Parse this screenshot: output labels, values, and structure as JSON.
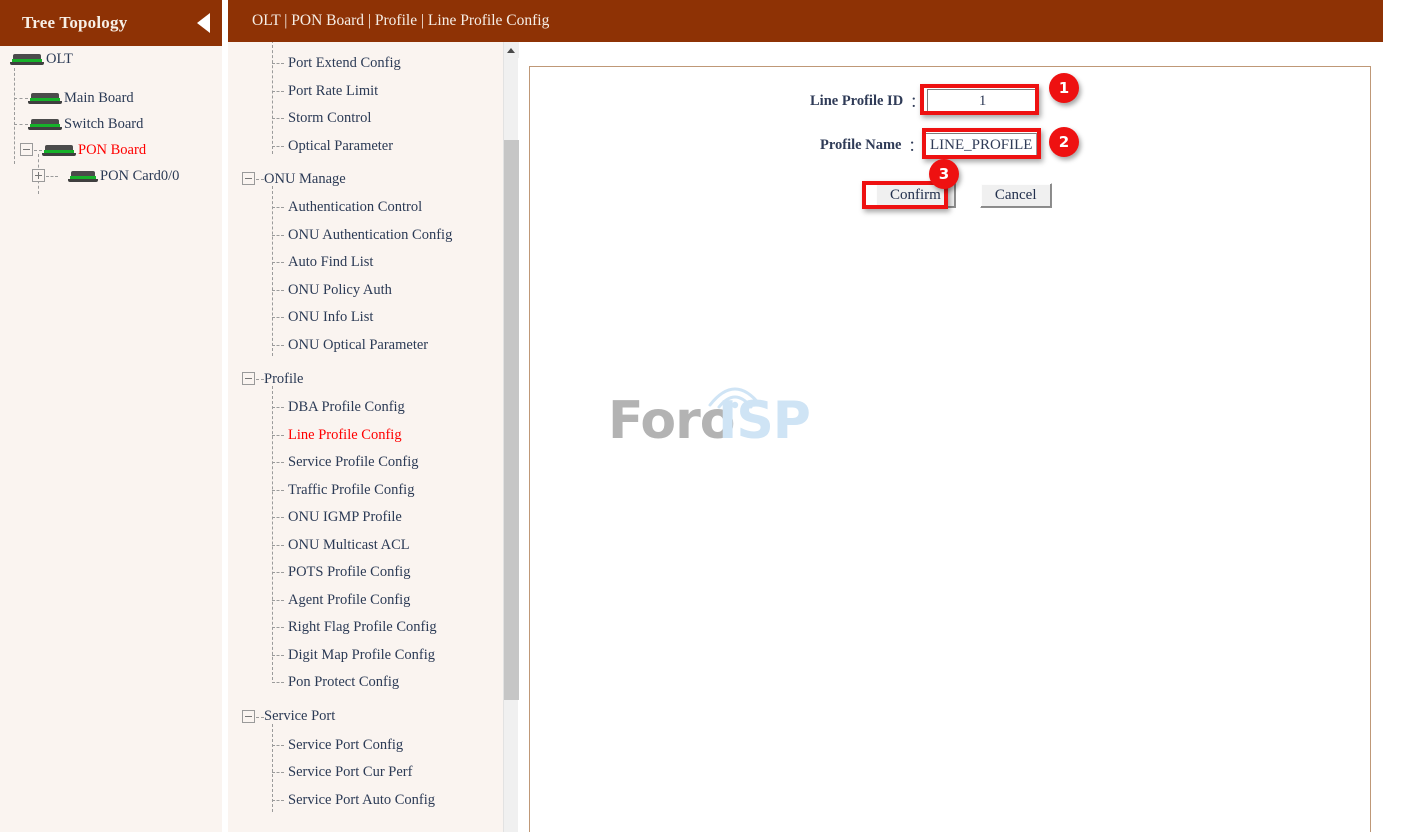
{
  "tree_panel": {
    "title": "Tree Topology",
    "collapse_icon": "triangle-left-icon",
    "nodes": [
      {
        "label": "OLT",
        "level": 0,
        "icon": "board-icon",
        "toggle": "none",
        "highlight": false
      },
      {
        "label": "Main Board",
        "level": 1,
        "icon": "board-icon",
        "toggle": "none",
        "highlight": false
      },
      {
        "label": "Switch Board",
        "level": 1,
        "icon": "board-icon",
        "toggle": "none",
        "highlight": false
      },
      {
        "label": "PON Board",
        "level": 1,
        "icon": "board-icon",
        "toggle": "minus",
        "highlight": true
      },
      {
        "label": "PON Card0/0",
        "level": 2,
        "icon": "board-icon",
        "toggle": "plus",
        "highlight": false
      }
    ]
  },
  "header": {
    "breadcrumb": "OLT | PON Board | Profile | Line Profile Config"
  },
  "menu": {
    "clipped_top_item": "",
    "groups": [
      {
        "id": "port-group-continued",
        "header": null,
        "items": [
          "Port Extend Config",
          "Port Rate Limit",
          "Storm Control",
          "Optical Parameter"
        ],
        "active": null
      },
      {
        "id": "onu-manage",
        "header": "ONU Manage",
        "toggle": "minus",
        "items": [
          "Authentication Control",
          "ONU Authentication Config",
          "Auto Find List",
          "ONU Policy Auth",
          "ONU Info List",
          "ONU Optical Parameter"
        ],
        "active": null
      },
      {
        "id": "profile",
        "header": "Profile",
        "toggle": "minus",
        "items": [
          "DBA Profile Config",
          "Line Profile Config",
          "Service Profile Config",
          "Traffic Profile Config",
          "ONU IGMP Profile",
          "ONU Multicast ACL",
          "POTS Profile Config",
          "Agent Profile Config",
          "Right Flag Profile Config",
          "Digit Map Profile Config",
          "Pon Protect Config"
        ],
        "active": "Line Profile Config"
      },
      {
        "id": "service-port",
        "header": "Service Port",
        "toggle": "minus",
        "items": [
          "Service Port Config",
          "Service Port Cur Perf",
          "Service Port Auto Config"
        ],
        "active": null
      }
    ]
  },
  "form": {
    "fields": [
      {
        "label": "Line Profile ID",
        "colon": "：",
        "value": "1"
      },
      {
        "label": "Profile Name",
        "colon": "：",
        "value": "LINE_PROFILE"
      }
    ],
    "buttons": {
      "confirm": "Confirm",
      "cancel": "Cancel"
    }
  },
  "annotations": {
    "badges": [
      "1",
      "2",
      "3"
    ],
    "color": "#ee1111"
  },
  "watermark": {
    "text_primary": "Foro",
    "text_accent": "ISP",
    "color_primary": "#b3b3b3",
    "color_accent": "#cfe4f5"
  },
  "colors": {
    "header_brown": "#8e3205",
    "panel_cream": "#faf4f0",
    "label_navy": "#2b3a55",
    "active_red": "#ff0000",
    "content_border": "#bf9877"
  }
}
